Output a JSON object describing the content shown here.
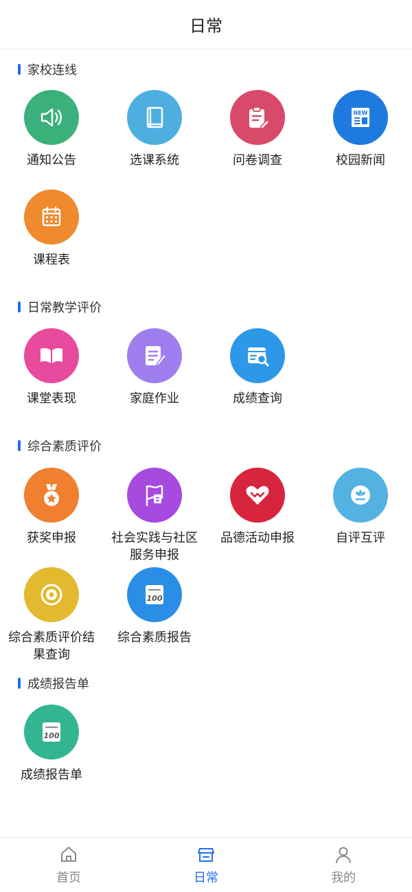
{
  "header": {
    "title": "日常"
  },
  "sections": [
    {
      "title": "家校连线",
      "items": [
        {
          "label": "通知公告",
          "icon": "speaker-icon",
          "color": "#3bb07a"
        },
        {
          "label": "选课系统",
          "icon": "book-icon",
          "color": "#4eaee0"
        },
        {
          "label": "问卷调查",
          "icon": "clipboard-edit-icon",
          "color": "#d94a6a"
        },
        {
          "label": "校园新闻",
          "icon": "newspaper-icon",
          "color": "#1f7ae0"
        },
        {
          "label": "课程表",
          "icon": "calendar-icon",
          "color": "#ef8a2f"
        }
      ]
    },
    {
      "title": "日常教学评价",
      "items": [
        {
          "label": "课堂表现",
          "icon": "open-book-icon",
          "color": "#e84a9e"
        },
        {
          "label": "家庭作业",
          "icon": "document-pen-icon",
          "color": "#9f7ef0"
        },
        {
          "label": "成绩查询",
          "icon": "search-grades-icon",
          "color": "#2e98e8"
        }
      ]
    },
    {
      "title": "综合素质评价",
      "items": [
        {
          "label": "获奖申报",
          "icon": "medal-icon",
          "color": "#f07f30"
        },
        {
          "label": "社会实践与社区服务申报",
          "icon": "flag-document-icon",
          "color": "#a64ae0"
        },
        {
          "label": "品德活动申报",
          "icon": "heart-icon",
          "color": "#d8253e"
        },
        {
          "label": "自评互评",
          "icon": "flower-icon",
          "color": "#54b2e2"
        },
        {
          "label": "综合素质评价结果查询",
          "icon": "target-icon",
          "color": "#e2b92f"
        },
        {
          "label": "综合素质报告",
          "icon": "score-100-icon",
          "color": "#2a8ee6"
        }
      ]
    },
    {
      "title": "成绩报告单",
      "items": [
        {
          "label": "成绩报告单",
          "icon": "score-100-icon",
          "color": "#33b592"
        }
      ]
    }
  ],
  "tabbar": [
    {
      "label": "首页",
      "icon": "home-icon",
      "active": false
    },
    {
      "label": "日常",
      "icon": "daily-store-icon",
      "active": true
    },
    {
      "label": "我的",
      "icon": "user-icon",
      "active": false
    }
  ],
  "colors": {
    "accent": "#1f6fe8",
    "inactive": "#888888"
  }
}
